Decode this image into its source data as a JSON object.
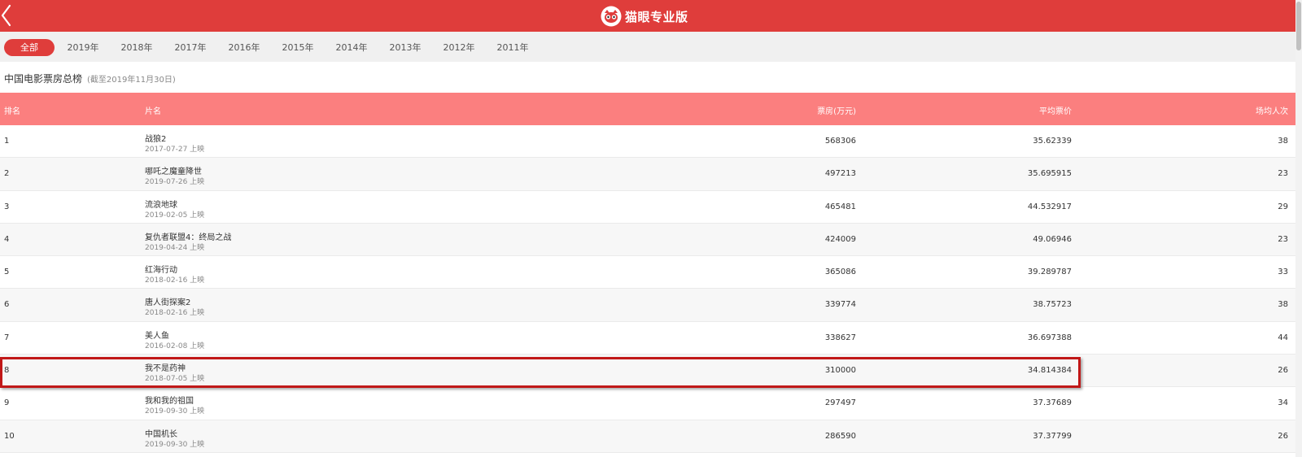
{
  "header": {
    "title": "猫眼专业版",
    "back_icon": "chevron-left-icon",
    "logo_icon": "cat-eye-logo-icon",
    "color": "#df3d3b"
  },
  "tabs": [
    {
      "label": "全部",
      "active": true
    },
    {
      "label": "2019年",
      "active": false
    },
    {
      "label": "2018年",
      "active": false
    },
    {
      "label": "2017年",
      "active": false
    },
    {
      "label": "2016年",
      "active": false
    },
    {
      "label": "2015年",
      "active": false
    },
    {
      "label": "2014年",
      "active": false
    },
    {
      "label": "2013年",
      "active": false
    },
    {
      "label": "2012年",
      "active": false
    },
    {
      "label": "2011年",
      "active": false
    }
  ],
  "section": {
    "title": "中国电影票房总榜",
    "subtitle": "(截至2019年11月30日)"
  },
  "table": {
    "header_color": "#fb7f7f",
    "columns": {
      "rank": "排名",
      "name": "片名",
      "box_office": "票房(万元)",
      "avg_price": "平均票价",
      "avg_people": "场均人次"
    },
    "rows": [
      {
        "rank": "1",
        "name": "战狼2",
        "date": "2017-07-27 上映",
        "box_office": "568306",
        "avg_price": "35.62339",
        "avg_people": "38"
      },
      {
        "rank": "2",
        "name": "哪吒之魔童降世",
        "date": "2019-07-26 上映",
        "box_office": "497213",
        "avg_price": "35.695915",
        "avg_people": "23"
      },
      {
        "rank": "3",
        "name": "流浪地球",
        "date": "2019-02-05 上映",
        "box_office": "465481",
        "avg_price": "44.532917",
        "avg_people": "29"
      },
      {
        "rank": "4",
        "name": "复仇者联盟4：终局之战",
        "date": "2019-04-24 上映",
        "box_office": "424009",
        "avg_price": "49.06946",
        "avg_people": "23"
      },
      {
        "rank": "5",
        "name": "红海行动",
        "date": "2018-02-16 上映",
        "box_office": "365086",
        "avg_price": "39.289787",
        "avg_people": "33"
      },
      {
        "rank": "6",
        "name": "唐人街探案2",
        "date": "2018-02-16 上映",
        "box_office": "339774",
        "avg_price": "38.75723",
        "avg_people": "38"
      },
      {
        "rank": "7",
        "name": "美人鱼",
        "date": "2016-02-08 上映",
        "box_office": "338627",
        "avg_price": "36.697388",
        "avg_people": "44"
      },
      {
        "rank": "8",
        "name": "我不是药神",
        "date": "2018-07-05 上映",
        "box_office": "310000",
        "avg_price": "34.814384",
        "avg_people": "26",
        "highlighted": true
      },
      {
        "rank": "9",
        "name": "我和我的祖国",
        "date": "2019-09-30 上映",
        "box_office": "297497",
        "avg_price": "37.37689",
        "avg_people": "34"
      },
      {
        "rank": "10",
        "name": "中国机长",
        "date": "2019-09-30 上映",
        "box_office": "286590",
        "avg_price": "37.37799",
        "avg_people": "26"
      }
    ]
  },
  "highlight_color": "#c11818"
}
